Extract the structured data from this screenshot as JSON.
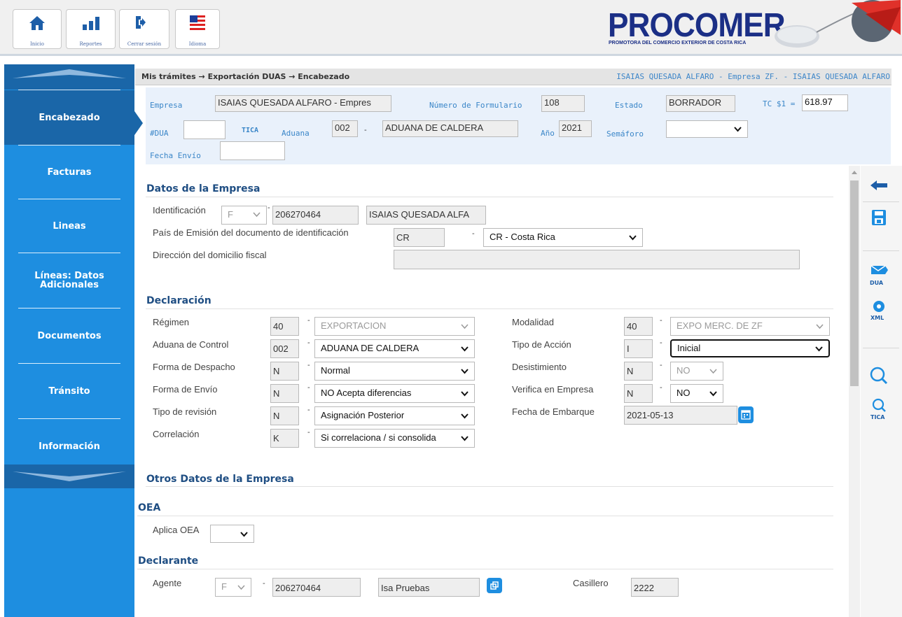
{
  "toolbar": {
    "inicio": "Inicio",
    "reportes": "Reportes",
    "cerrar": "Cerrar sesión",
    "idioma": "Idioma"
  },
  "brand": {
    "name": "PROCOMER",
    "tagline": "PROMOTORA DEL COMERCIO EXTERIOR DE COSTA RICA",
    "color": "#1b2f86"
  },
  "breadcrumb": {
    "path": "Mis trámites → Exportación DUAS → Encabezado",
    "user": "ISAIAS QUESADA ALFARO - Empresa ZF. - ISAIAS QUESADA ALFARO"
  },
  "nav": [
    {
      "label": "Encabezado"
    },
    {
      "label": "Facturas"
    },
    {
      "label": "Lineas"
    },
    {
      "label": "Líneas: Datos Adicionales"
    },
    {
      "label": "Documentos"
    },
    {
      "label": "Tránsito"
    },
    {
      "label": "Información"
    }
  ],
  "header": {
    "empresa_label": "Empresa",
    "empresa_value": "ISAIAS QUESADA ALFARO - Empres",
    "numform_label": "Número de Formulario",
    "numform_value": "108",
    "estado_label": "Estado",
    "estado_value": "BORRADOR",
    "tc_label": "TC $1 =",
    "tc_value": "618.97",
    "dua_label": "#DUA",
    "dua_value": "",
    "tica_label": "TICA",
    "aduana_label": "Aduana",
    "aduana_code": "002",
    "aduana_name": "ADUANA DE CALDERA",
    "anio_label": "Año",
    "anio_value": "2021",
    "semaforo_label": "Semáforo",
    "semaforo_value": "",
    "fecha_envio_label": "Fecha Envío",
    "fecha_envio_value": ""
  },
  "datos_empresa": {
    "title": "Datos de la Empresa",
    "identificacion_label": "Identificación",
    "id_type": "F",
    "id_number": "206270464",
    "id_name": "ISAIAS QUESADA ALFA",
    "pais_label": "País de Emisión del documento de identificación",
    "pais_code": "CR",
    "pais_name": "CR - Costa Rica",
    "direccion_label": "Dirección del domicilio fiscal",
    "direccion_value": ""
  },
  "declaracion": {
    "title": "Declaración",
    "left": [
      {
        "label": "Régimen",
        "code": "40",
        "value": "EXPORTACION",
        "disabled": true
      },
      {
        "label": "Aduana de Control",
        "code": "002",
        "value": "ADUANA DE CALDERA",
        "disabled": false
      },
      {
        "label": "Forma de Despacho",
        "code": "N",
        "value": "Normal",
        "disabled": false
      },
      {
        "label": "Forma de Envío",
        "code": "N",
        "value": "NO Acepta diferencias",
        "disabled": false
      },
      {
        "label": "Tipo de revisión",
        "code": "N",
        "value": "Asignación Posterior",
        "disabled": false
      },
      {
        "label": "Correlación",
        "code": "K",
        "value": "Si correlaciona / si consolida",
        "disabled": false
      }
    ],
    "modalidad_label": "Modalidad",
    "modalidad_code": "40",
    "modalidad_value": "EXPO MERC. DE ZF",
    "tipo_accion_label": "Tipo de Acción",
    "tipo_accion_code": "I",
    "tipo_accion_value": "Inicial",
    "desist_label": "Desistimiento",
    "desist_code": "N",
    "desist_value": "NO",
    "verifica_label": "Verifica en Empresa",
    "verifica_code": "N",
    "verifica_value": "NO",
    "fecha_emb_label": "Fecha de Embarque",
    "fecha_emb_value": "2021-05-13"
  },
  "otros": {
    "title": "Otros Datos de la Empresa"
  },
  "oea": {
    "title": "OEA",
    "aplica_label": "Aplica OEA",
    "aplica_value": ""
  },
  "declarante": {
    "title": "Declarante",
    "agente_label": "Agente",
    "agente_type": "F",
    "agente_id": "206270464",
    "agente_name": "Isa Pruebas",
    "casillero_label": "Casillero",
    "casillero_value": "2222"
  },
  "side_actions": {
    "dua": "DUA",
    "xml": "XML",
    "tica": "TICA"
  },
  "colors": {
    "nav": "#1e8ee0",
    "nav_active": "#1a66a8",
    "label_blue": "#3a86c8",
    "section": "#1f4e83"
  }
}
